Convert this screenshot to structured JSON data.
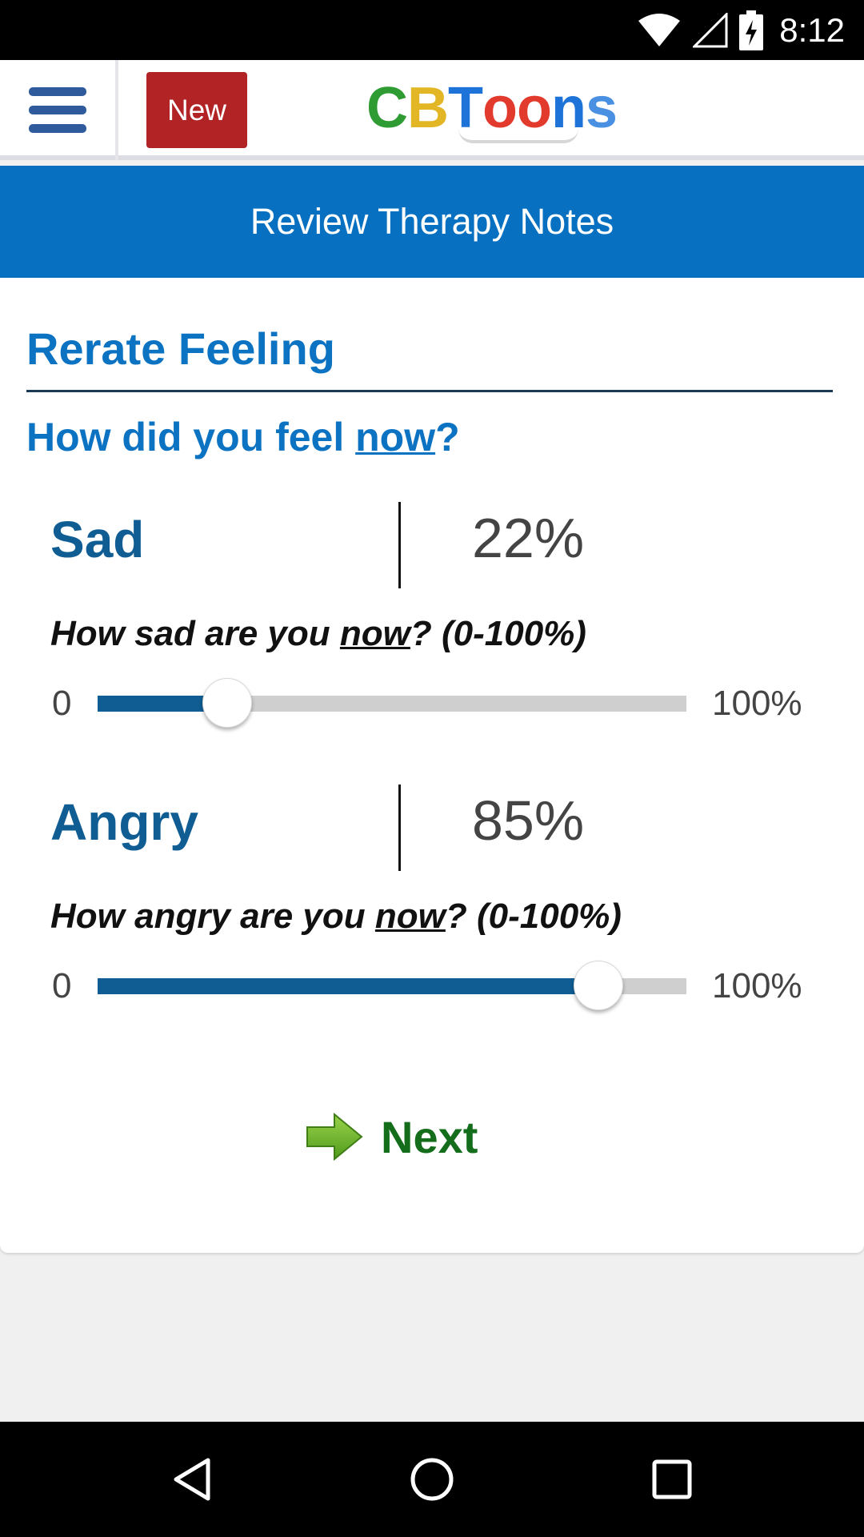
{
  "status_bar": {
    "time": "8:12",
    "icons": [
      "wifi-icon",
      "signal-icon",
      "battery-charging-icon"
    ]
  },
  "header": {
    "menu_icon": "hamburger-menu-icon",
    "new_label": "New",
    "logo_letters": [
      {
        "char": "C",
        "color": "#2e9b33"
      },
      {
        "char": "B",
        "color": "#e2b624"
      },
      {
        "char": "T",
        "color": "#1e73d8"
      },
      {
        "char": "o",
        "color": "#e23b2e"
      },
      {
        "char": "o",
        "color": "#e23b2e"
      },
      {
        "char": "n",
        "color": "#1e73d8"
      },
      {
        "char": "s",
        "color": "#4a90e2"
      }
    ]
  },
  "title_bar": {
    "title": "Review Therapy Notes"
  },
  "content": {
    "section_title": "Rerate Feeling",
    "question_prefix": "How did you feel ",
    "question_emphasis": "now",
    "question_suffix": "?",
    "feelings": [
      {
        "name": "Sad",
        "value_text": "22%",
        "value": 22,
        "q_prefix": "How sad are you ",
        "q_emphasis": "now",
        "q_suffix": "? (0-100%)",
        "slider_min": "0",
        "slider_max": "100%"
      },
      {
        "name": "Angry",
        "value_text": "85%",
        "value": 85,
        "q_prefix": "How angry are you ",
        "q_emphasis": "now",
        "q_suffix": "? (0-100%)",
        "slider_min": "0",
        "slider_max": "100%"
      }
    ],
    "next_label": "Next",
    "next_icon": "green-arrow-right-icon"
  },
  "colors": {
    "accent_blue": "#0770c1",
    "heading_blue": "#0c73c2",
    "feeling_blue": "#0f5d93",
    "new_red": "#b22326",
    "next_green": "#136d1b"
  },
  "nav_bar": {
    "icons": [
      "back-icon",
      "home-icon",
      "recents-icon"
    ]
  }
}
